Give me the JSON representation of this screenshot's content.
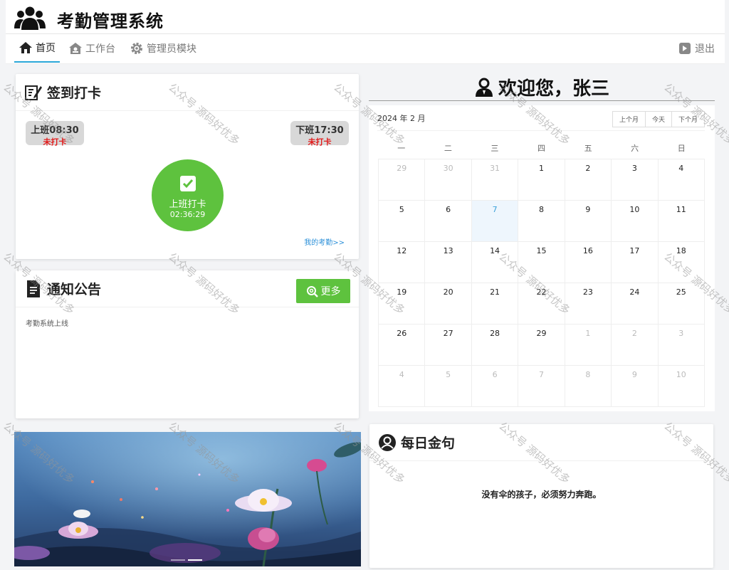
{
  "app": {
    "title": "考勤管理系统"
  },
  "nav": {
    "home": "首页",
    "workbench": "工作台",
    "admin": "管理员模块",
    "logout": "退出"
  },
  "checkin": {
    "title": "签到打卡",
    "on_shift_time": "上班08:30",
    "on_shift_status": "未打卡",
    "off_shift_time": "下班17:30",
    "off_shift_status": "未打卡",
    "punch_label": "上班打卡",
    "punch_clock": "02:36:29",
    "my_attendance": "我的考勤>>"
  },
  "notice": {
    "title": "通知公告",
    "more": "更多",
    "items": [
      "考勤系统上线"
    ]
  },
  "welcome": {
    "text": "欢迎您，张三"
  },
  "calendar": {
    "header": "2024 年 2 月",
    "prev": "上个月",
    "today": "今天",
    "next": "下个月",
    "weekdays": [
      "一",
      "二",
      "三",
      "四",
      "五",
      "六",
      "日"
    ],
    "days": [
      {
        "d": "29",
        "dim": true
      },
      {
        "d": "30",
        "dim": true
      },
      {
        "d": "31",
        "dim": true
      },
      {
        "d": "1"
      },
      {
        "d": "2"
      },
      {
        "d": "3"
      },
      {
        "d": "4"
      },
      {
        "d": "5"
      },
      {
        "d": "6"
      },
      {
        "d": "7",
        "today": true
      },
      {
        "d": "8"
      },
      {
        "d": "9"
      },
      {
        "d": "10"
      },
      {
        "d": "11"
      },
      {
        "d": "12"
      },
      {
        "d": "13"
      },
      {
        "d": "14"
      },
      {
        "d": "15"
      },
      {
        "d": "16"
      },
      {
        "d": "17"
      },
      {
        "d": "18"
      },
      {
        "d": "19"
      },
      {
        "d": "20"
      },
      {
        "d": "21"
      },
      {
        "d": "22"
      },
      {
        "d": "23"
      },
      {
        "d": "24"
      },
      {
        "d": "25"
      },
      {
        "d": "26"
      },
      {
        "d": "27"
      },
      {
        "d": "28"
      },
      {
        "d": "29"
      },
      {
        "d": "1",
        "dim": true
      },
      {
        "d": "2",
        "dim": true
      },
      {
        "d": "3",
        "dim": true
      },
      {
        "d": "4",
        "dim": true
      },
      {
        "d": "5",
        "dim": true
      },
      {
        "d": "6",
        "dim": true
      },
      {
        "d": "7",
        "dim": true
      },
      {
        "d": "8",
        "dim": true
      },
      {
        "d": "9",
        "dim": true
      },
      {
        "d": "10",
        "dim": true
      }
    ]
  },
  "quote": {
    "title": "每日金句",
    "text": "没有伞的孩子，必须努力奔跑。"
  },
  "watermark": {
    "text": "公众号 源码好优多"
  },
  "colors": {
    "accent_green": "#5ec23e",
    "tab_underline": "#2aa7d8",
    "status_red": "#e21b1b",
    "link_blue": "#2a8fd8"
  }
}
